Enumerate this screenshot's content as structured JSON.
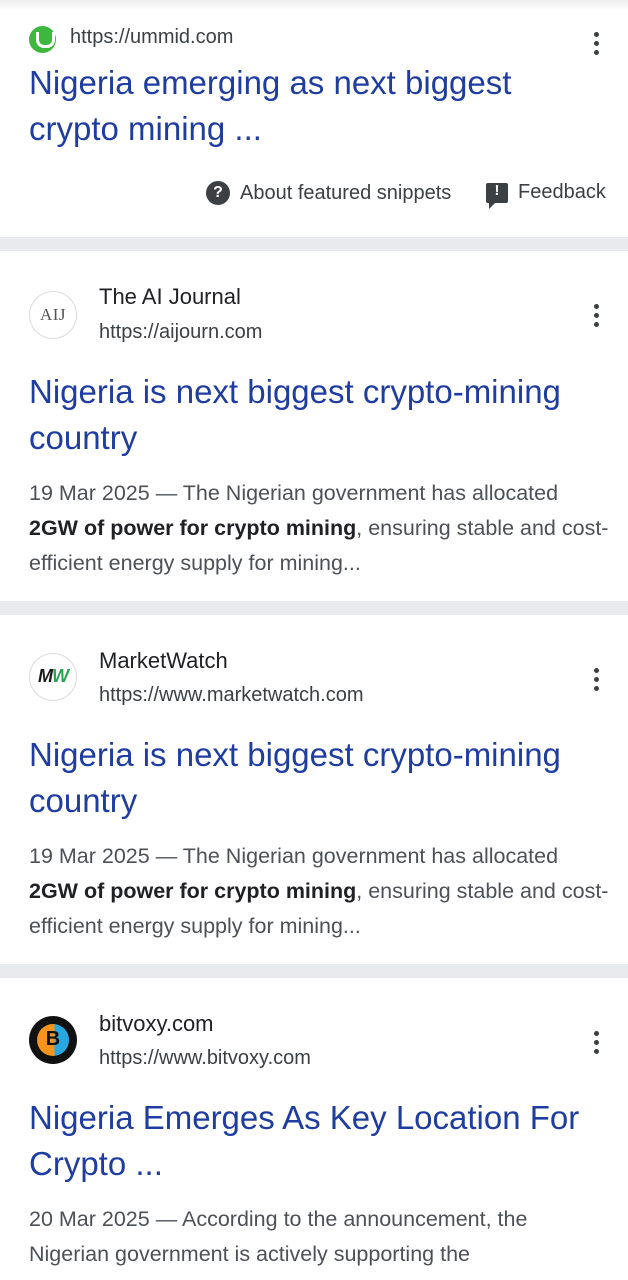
{
  "featured": {
    "url": "https://ummid.com",
    "title": "Nigeria emerging as next biggest crypto mining ...",
    "about_label": "About featured snippets",
    "feedback_label": "Feedback"
  },
  "results": [
    {
      "site_name": "The AI Journal",
      "favicon_text": "AIJ",
      "url": "https://aijourn.com",
      "title": "Nigeria is next biggest crypto-mining country",
      "date": "19 Mar 2025",
      "snippet_pre": "The Nigerian government has allocated ",
      "snippet_bold": "2GW of power for crypto mining",
      "snippet_post": ", ensuring stable and cost-efficient energy supply for mining..."
    },
    {
      "site_name": "MarketWatch",
      "favicon_text": "MW",
      "url": "https://www.marketwatch.com",
      "title": "Nigeria is next biggest crypto-mining country",
      "date": "19 Mar 2025",
      "snippet_pre": "The Nigerian government has allocated ",
      "snippet_bold": "2GW of power for crypto mining",
      "snippet_post": ", ensuring stable and cost-efficient energy supply for mining..."
    },
    {
      "site_name": "bitvoxy.com",
      "favicon_text": "B",
      "url": "https://www.bitvoxy.com",
      "title": "Nigeria Emerges As Key Location For Crypto ...",
      "date": "20 Mar 2025",
      "snippet_pre": "According to the announcement, the Nigerian government is actively supporting the",
      "snippet_bold": "",
      "snippet_post": ""
    }
  ],
  "date_separator": " — ",
  "icons": {
    "more": "more-vert-icon",
    "help": "help-circle-icon",
    "feedback": "feedback-icon"
  }
}
